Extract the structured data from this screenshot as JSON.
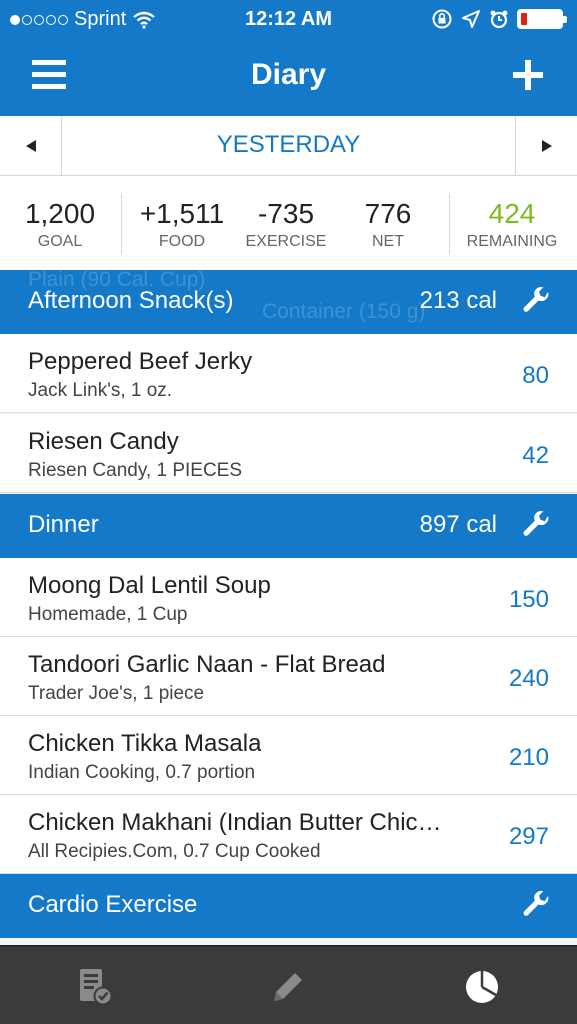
{
  "status_bar": {
    "carrier": "Sprint",
    "signal_dots_filled": 1,
    "signal_dots_total": 5,
    "time": "12:12 AM",
    "battery_level": 0.15,
    "battery_color": "#e0211b"
  },
  "nav": {
    "title": "Diary",
    "menu_icon": "hamburger-menu-icon",
    "add_icon": "plus-icon"
  },
  "date_nav": {
    "label": "YESTERDAY",
    "prev_icon": "triangle-left-icon",
    "next_icon": "triangle-right-icon"
  },
  "summary": {
    "goal": {
      "value": "1,200",
      "label": "GOAL"
    },
    "food": {
      "value": "+1,511",
      "label": "FOOD"
    },
    "exercise": {
      "value": "-735",
      "label": "EXERCISE"
    },
    "net": {
      "value": "776",
      "label": "NET"
    },
    "remaining": {
      "value": "424",
      "label": "REMAINING",
      "color": "#7dbb1d"
    }
  },
  "sections": {
    "afternoon_snacks": {
      "title": "Afternoon Snack(s)",
      "calories": "213 cal",
      "ghost_line1": "Plain (90 Cal. Cup)",
      "ghost_line2": "Container (150 g)",
      "items": [
        {
          "name": "Peppered Beef Jerky",
          "detail": "Jack Link's, 1 oz.",
          "calories": "80"
        },
        {
          "name": "Riesen Candy",
          "detail": "Riesen Candy, 1 PIECES",
          "calories": "42"
        }
      ]
    },
    "dinner": {
      "title": "Dinner",
      "calories": "897 cal",
      "items": [
        {
          "name": "Moong Dal Lentil Soup",
          "detail": "Homemade, 1 Cup",
          "calories": "150"
        },
        {
          "name": "Tandoori Garlic Naan - Flat Bread",
          "detail": "Trader Joe's, 1 piece",
          "calories": "240"
        },
        {
          "name": "Chicken Tikka Masala",
          "detail": "Indian Cooking, 0.7 portion",
          "calories": "210"
        },
        {
          "name": "Chicken Makhani (Indian Butter Chic…",
          "detail": "All Recipies.Com, 0.7 Cup Cooked",
          "calories": "297"
        }
      ]
    },
    "cardio": {
      "title": "Cardio Exercise"
    }
  },
  "tab_bar": {
    "tabs": [
      "diary-check-icon",
      "pencil-icon",
      "pie-chart-icon"
    ]
  },
  "colors": {
    "brand_blue": "#1479c8",
    "remaining_green": "#7dbb1d",
    "tabbar": "#3b3b3b"
  }
}
